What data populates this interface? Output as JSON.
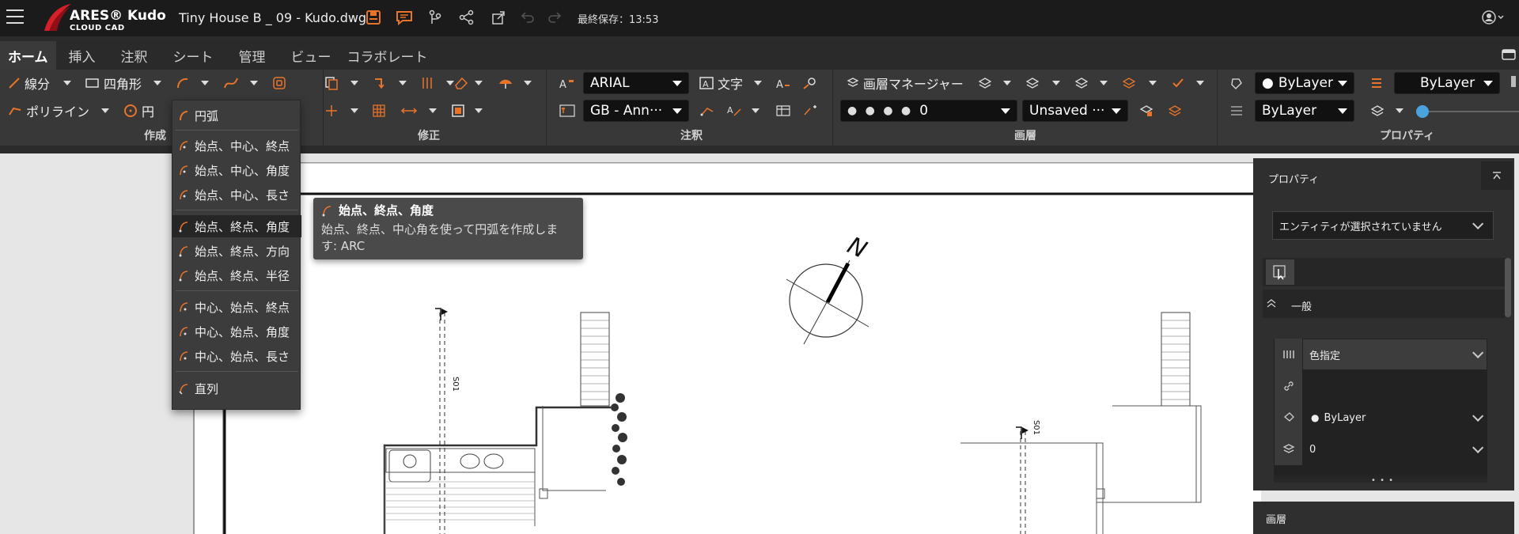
{
  "app": {
    "logo_line1": "ARES® Kudo",
    "logo_line2": "CLOUD CAD",
    "file_name": "Tiny House B _ 09 - Kudo.dwg",
    "last_saved": "最終保存：13:53"
  },
  "tabs": [
    {
      "label": "ホーム",
      "active": true
    },
    {
      "label": "挿入"
    },
    {
      "label": "注釈"
    },
    {
      "label": "シート"
    },
    {
      "label": "管理"
    },
    {
      "label": "ビュー"
    },
    {
      "label": "コラボレート"
    }
  ],
  "ribbon": {
    "draw": {
      "line": "線分",
      "rect": "四角形",
      "polyline": "ポリライン",
      "circle": "円",
      "group": "作成"
    },
    "modify": {
      "group": "修正"
    },
    "annotate": {
      "font": "ARIAL",
      "text": "文字",
      "dimstyle": "GB - Ann···",
      "group": "注釈"
    },
    "layers": {
      "manager": "画層マネージャー",
      "current": "0",
      "state": "Unsaved ···",
      "group": "画層"
    },
    "properties": {
      "color": "ByLayer",
      "linetype": "ByLayer",
      "lineweight": "ByLayer",
      "group": "プロパティ"
    }
  },
  "arc_menu": {
    "header": "円弧",
    "items": [
      "始点、中心、終点",
      "始点、中心、角度",
      "始点、中心、長さ",
      "始点、終点、角度",
      "始点、終点、方向",
      "始点、終点、半径",
      "中心、始点、終点",
      "中心、始点、角度",
      "中心、始点、長さ",
      "直列"
    ],
    "highlighted": "始点、終点、角度"
  },
  "tooltip": {
    "title": "始点、終点、角度",
    "desc_line1": "始点、終点、中心角を使って円弧を作成しま",
    "desc_line2": "す: ARC"
  },
  "drawing": {
    "north": "N",
    "section1": "S01",
    "section2": "S01"
  },
  "properties_panel": {
    "title": "プロパティ",
    "selection": "エンティティが選択されていません",
    "section": "一般",
    "color_mode": "色指定",
    "layer_color": "ByLayer",
    "layer": "0",
    "more": "• • •",
    "bottom_section": "画層"
  },
  "colors": {
    "accent": "#e8742a",
    "ribbon_bg": "#383838",
    "topbar_bg": "#1b1b1b",
    "canvas_bg": "#e6e6e6",
    "slider_blue": "#4aa3df"
  }
}
